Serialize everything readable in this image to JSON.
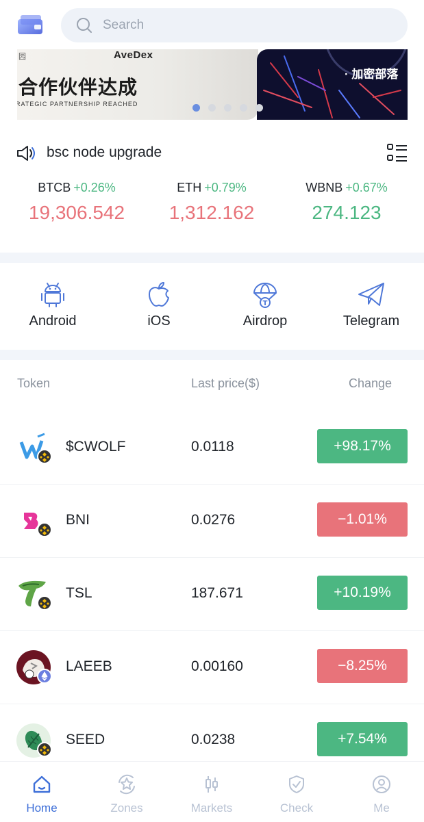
{
  "search": {
    "placeholder": "Search"
  },
  "banner": {
    "brand": "AveDex",
    "mark": "园",
    "headline": "合作伙伴达成",
    "subtitle": "RATEGIC PARTNERSHIP REACHED",
    "right_text": "· 加密部落"
  },
  "notice": {
    "text": "bsc node upgrade"
  },
  "tickers": [
    {
      "symbol": "BTCB",
      "change": "+0.26%",
      "price": "19,306.542",
      "price_color": "#e8737a"
    },
    {
      "symbol": "ETH",
      "change": "+0.79%",
      "price": "1,312.162",
      "price_color": "#e8737a"
    },
    {
      "symbol": "WBNB",
      "change": "+0.67%",
      "price": "274.123",
      "price_color": "#4cb782"
    }
  ],
  "quick_links": [
    {
      "label": "Android",
      "icon": "android-icon"
    },
    {
      "label": "iOS",
      "icon": "apple-icon"
    },
    {
      "label": "Airdrop",
      "icon": "parachute-icon"
    },
    {
      "label": "Telegram",
      "icon": "paper-plane-icon"
    }
  ],
  "table": {
    "headers": {
      "token": "Token",
      "price": "Last price($)",
      "change": "Change"
    },
    "rows": [
      {
        "name": "$CWOLF",
        "price": "0.0118",
        "change": "+98.17%",
        "direction": "up",
        "chain": "bsc"
      },
      {
        "name": "BNI",
        "price": "0.0276",
        "change": "−1.01%",
        "direction": "down",
        "chain": "bsc"
      },
      {
        "name": "TSL",
        "price": "187.671",
        "change": "+10.19%",
        "direction": "up",
        "chain": "bsc"
      },
      {
        "name": "LAEEB",
        "price": "0.00160",
        "change": "−8.25%",
        "direction": "down",
        "chain": "eth"
      },
      {
        "name": "SEED",
        "price": "0.0238",
        "change": "+7.54%",
        "direction": "up",
        "chain": "bsc"
      }
    ]
  },
  "tabs": [
    {
      "label": "Home",
      "icon": "home-icon",
      "active": true
    },
    {
      "label": "Zones",
      "icon": "zones-icon",
      "active": false
    },
    {
      "label": "Markets",
      "icon": "candlestick-icon",
      "active": false
    },
    {
      "label": "Check",
      "icon": "shield-check-icon",
      "active": false
    },
    {
      "label": "Me",
      "icon": "user-icon",
      "active": false
    }
  ],
  "colors": {
    "up": "#4cb782",
    "down": "#e8737a",
    "accent": "#3e6fd8",
    "inactive": "#b8c2d3"
  }
}
